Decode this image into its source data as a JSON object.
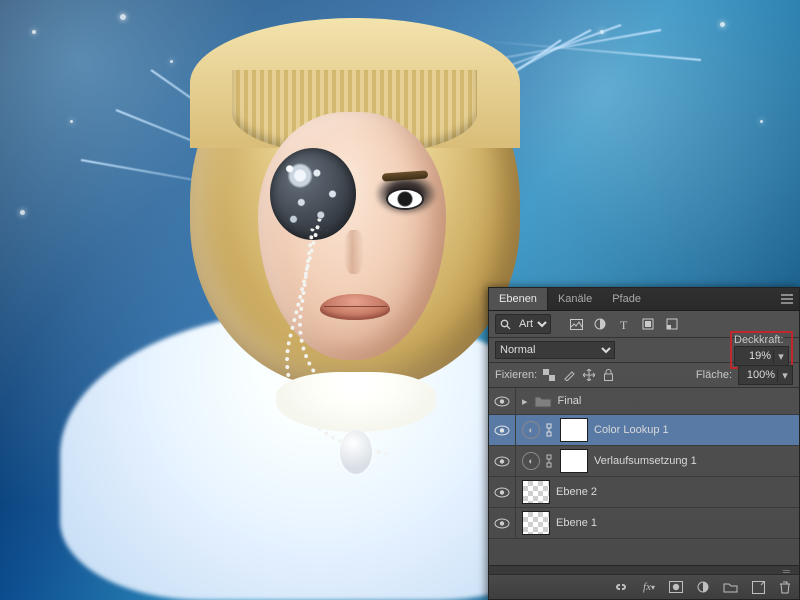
{
  "panel": {
    "tabs": {
      "layers": "Ebenen",
      "channels": "Kanäle",
      "paths": "Pfade"
    },
    "filter_label": "Art",
    "blend_mode": "Normal",
    "opacity_label": "Deckkraft:",
    "opacity_value": "19%",
    "lock_label": "Fixieren:",
    "fill_label": "Fläche:",
    "fill_value": "100%"
  },
  "layers": [
    {
      "name": "Final"
    },
    {
      "name": "Color Lookup 1"
    },
    {
      "name": "Verlaufsumsetzung 1"
    },
    {
      "name": "Ebene 2"
    },
    {
      "name": "Ebene 1"
    }
  ],
  "bottom_icons": [
    "link",
    "fx",
    "mask",
    "adjust",
    "group",
    "new",
    "trash"
  ]
}
